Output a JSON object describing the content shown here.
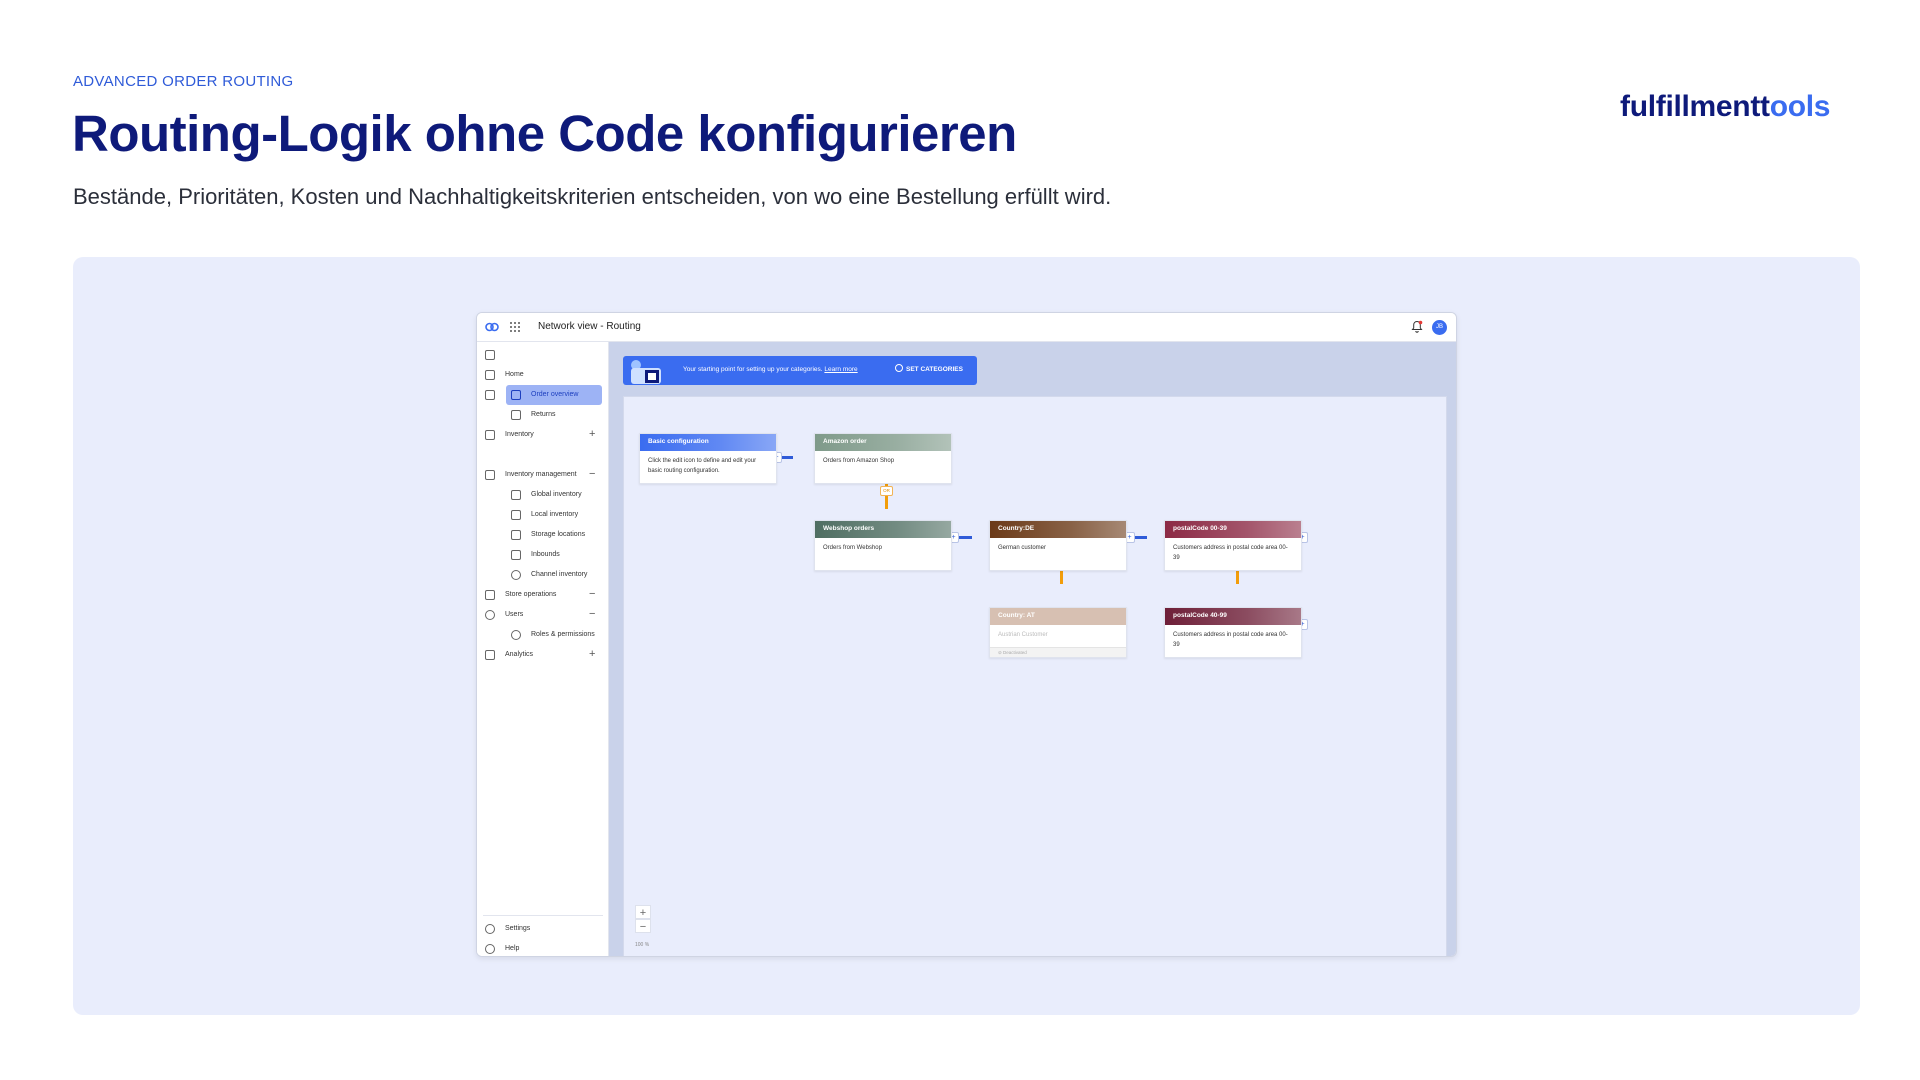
{
  "slide": {
    "eyebrow": "ADVANCED ORDER ROUTING",
    "headline": "Routing-Logik ohne Code konfigurieren",
    "subline": "Bestände, Prioritäten, Kosten und Nachhaltigkeitskriterien entscheiden, von wo eine Bestellung erfüllt wird.",
    "logo_main": "fulfillmentt",
    "logo_accent": "ools"
  },
  "app": {
    "title": "Network view - Routing",
    "avatar_initials": "JB",
    "sidebar": {
      "home": "Home",
      "order_overview": "Order overview",
      "returns": "Returns",
      "inventory": "Inventory",
      "inventory_management": "Inventory management",
      "global_inventory": "Global inventory",
      "local_inventory": "Local inventory",
      "storage_locations": "Storage locations",
      "inbounds": "Inbounds",
      "channel_inventory": "Channel inventory",
      "store_operations": "Store operations",
      "users": "Users",
      "roles_permissions": "Roles & permissions",
      "analytics": "Analytics",
      "settings": "Settings",
      "help": "Help",
      "plus_symbol": "+",
      "minus_symbol": "−"
    },
    "banner": {
      "text": "Your starting point for setting up your categories.",
      "link": "Learn more",
      "button": "SET CATEGORIES"
    },
    "zoom": {
      "plus": "+",
      "minus": "−",
      "percent": "100 %"
    },
    "or_label": "OR",
    "plus_label": "+",
    "nodes": {
      "basic": {
        "title": "Basic configuration",
        "body": "Click the edit icon to define and edit your basic routing configuration.",
        "color": "#3a6cf0"
      },
      "amazon": {
        "title": "Amazon order",
        "body": "Orders from Amazon Shop",
        "color": "#7f9a8a"
      },
      "webshop": {
        "title": "Webshop orders",
        "body": "Orders from Webshop",
        "color": "#4f6e62"
      },
      "country_de": {
        "title": "Country:DE",
        "body": "German customer",
        "color": "#6b3a18"
      },
      "postal_00_39": {
        "title": "postalCode 00-39",
        "body": "Customers address in postal code area 00-39",
        "color": "#8c2a45"
      },
      "country_at": {
        "title": "Country: AT",
        "body": "Austrian Customer",
        "footer": "Deactivated"
      },
      "postal_40_99": {
        "title": "postalCode 40-99",
        "body": "Customers address in postal code area 00-39",
        "color": "#6e1f38"
      }
    }
  }
}
